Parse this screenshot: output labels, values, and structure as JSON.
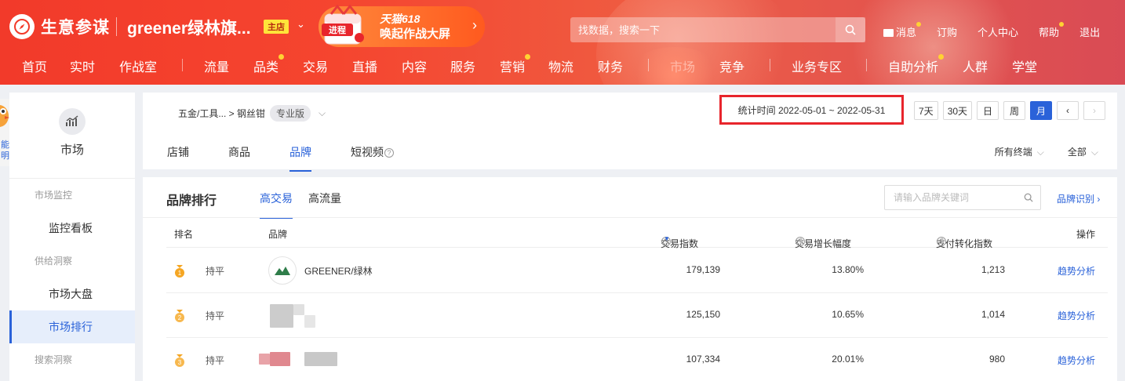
{
  "header": {
    "app_name": "生意参谋",
    "shop_name": "greener绿林旗...",
    "shop_badge": "主店",
    "promo": {
      "line1": "天猫618",
      "line2": "唤起作战大屏",
      "gift_label": "进程"
    },
    "search_placeholder": "找数据，搜索一下",
    "toplinks": [
      "消息",
      "订购",
      "个人中心",
      "帮助",
      "退出"
    ],
    "nav": [
      "首页",
      "实时",
      "作战室",
      "流量",
      "品类",
      "交易",
      "直播",
      "内容",
      "服务",
      "营销",
      "物流",
      "财务",
      "市场",
      "竞争",
      "业务专区",
      "自助分析",
      "人群",
      "学堂"
    ]
  },
  "sidebar": {
    "module": "市场",
    "groups": [
      {
        "label": "市场监控",
        "items": [
          "监控看板"
        ]
      },
      {
        "label": "供给洞察",
        "items": [
          "市场大盘",
          "市场排行"
        ]
      },
      {
        "label": "搜索洞察",
        "items": []
      }
    ],
    "active_item": "市场排行",
    "mascot_text": "能明"
  },
  "topbar": {
    "breadcrumb": "五金/工具... > 钢丝钳",
    "version_badge": "专业版",
    "date_label": "统计时间 2022-05-01 ~ 2022-05-31",
    "date_buttons": [
      "7天",
      "30天",
      "日",
      "周",
      "月"
    ],
    "selected_range": "月",
    "tabs": [
      "店铺",
      "商品",
      "品牌",
      "短视频"
    ],
    "active_tab": "品牌",
    "filters": [
      "所有终端",
      "全部"
    ]
  },
  "ranking": {
    "title": "品牌排行",
    "tabs": [
      "高交易",
      "高流量"
    ],
    "active_tab": "高交易",
    "search_placeholder": "请输入品牌关键词",
    "brand_identify": "品牌识别",
    "columns": [
      "排名",
      "品牌",
      "交易指数",
      "交易增长幅度",
      "支付转化指数",
      "操作"
    ],
    "rows": [
      {
        "rank": "1",
        "trend": "持平",
        "brand": "GREENER/绿林",
        "trade_index": "179,139",
        "growth": "13.80%",
        "conversion": "1,213",
        "action": "趋势分析"
      },
      {
        "rank": "2",
        "trend": "持平",
        "brand": "",
        "trade_index": "125,150",
        "growth": "10.65%",
        "conversion": "1,014",
        "action": "趋势分析"
      },
      {
        "rank": "3",
        "trend": "持平",
        "brand": "",
        "trade_index": "107,334",
        "growth": "20.01%",
        "conversion": "980",
        "action": "趋势分析"
      }
    ]
  },
  "colors": {
    "brand_red": "#f23a2a",
    "accent_blue": "#2a62d9",
    "highlight_box": "#e8252c",
    "medal_gold": "#f5a623"
  }
}
